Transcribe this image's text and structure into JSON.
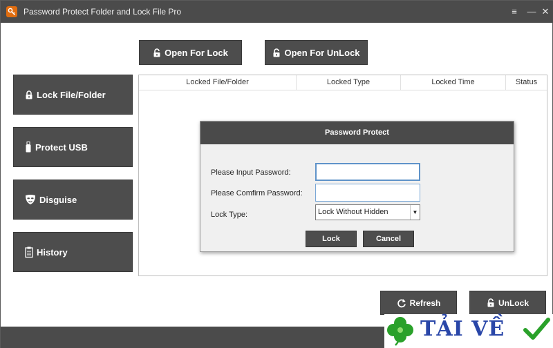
{
  "window": {
    "title": "Password Protect Folder and Lock File Pro"
  },
  "title_controls": {
    "menu_icon": "≡",
    "minimize_icon": "—",
    "close_icon": "✕"
  },
  "toolbar": {
    "open_for_lock": "Open For Lock",
    "open_for_unlock": "Open For UnLock"
  },
  "sidebar": {
    "items": [
      {
        "label": "Lock File/Folder",
        "icon": "lock-icon"
      },
      {
        "label": "Protect USB",
        "icon": "usb-icon"
      },
      {
        "label": "Disguise",
        "icon": "mask-icon"
      },
      {
        "label": "History",
        "icon": "clipboard-icon"
      }
    ]
  },
  "table": {
    "columns": [
      "Locked File/Folder",
      "Locked Type",
      "Locked Time",
      "Status"
    ],
    "rows": []
  },
  "dialog": {
    "title": "Password Protect",
    "password_label": "Please Input Password:",
    "password_value": "",
    "confirm_label": "Please Comfirm Password:",
    "confirm_value": "",
    "lock_type_label": "Lock Type:",
    "lock_type_value": "Lock Without Hidden",
    "lock_button": "Lock",
    "cancel_button": "Cancel"
  },
  "bottom": {
    "refresh": "Refresh",
    "unlock": "UnLock"
  },
  "watermark": {
    "text": "TẢI VỀ"
  },
  "colors": {
    "titlebar": "#4b4b4b",
    "button": "#4d4d4d",
    "app_icon": "#e06d10",
    "input_border": "#7aa7d6",
    "watermark_blue": "#2946a8",
    "watermark_green": "#2aa12a"
  }
}
